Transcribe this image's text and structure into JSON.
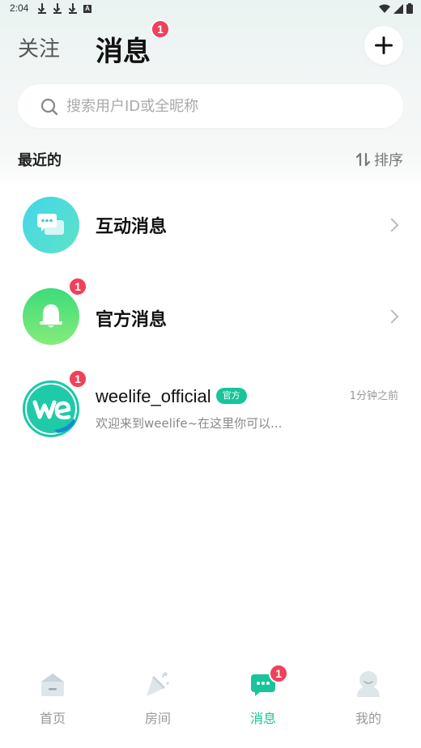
{
  "status_bar": {
    "time": "2:04",
    "a_label": "A"
  },
  "header": {
    "tab_follow": "关注",
    "tab_messages": "消息",
    "messages_badge": "1"
  },
  "search": {
    "placeholder": "搜索用户ID或全昵称"
  },
  "section": {
    "recent_label": "最近的",
    "sort_label": "排序"
  },
  "conversations": [
    {
      "title": "互动消息"
    },
    {
      "title": "官方消息",
      "badge": "1"
    },
    {
      "title": "weelife_official",
      "tag": "官方",
      "badge": "1",
      "time": "1分钟之前",
      "preview": "欢迎来到weelife~在这里你可以..."
    }
  ],
  "bottom_nav": [
    {
      "label": "首页"
    },
    {
      "label": "房间"
    },
    {
      "label": "消息",
      "badge": "1",
      "active": true
    },
    {
      "label": "我的"
    }
  ],
  "colors": {
    "accent": "#19c49a",
    "badge": "#f0415a"
  }
}
